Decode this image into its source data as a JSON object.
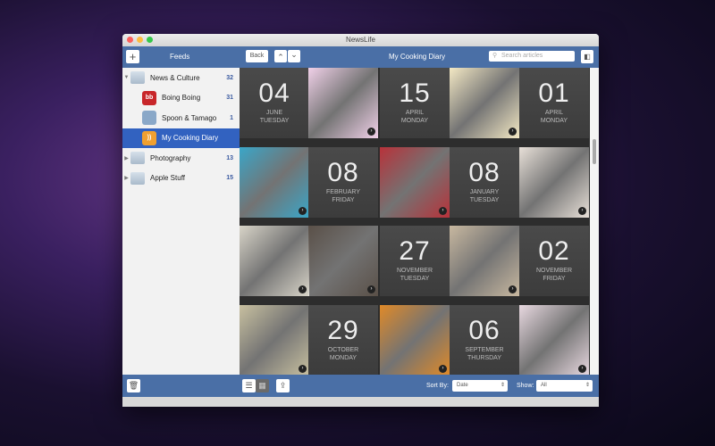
{
  "window": {
    "title": "NewsLife"
  },
  "toolbar": {
    "add": "+",
    "feeds": "Feeds",
    "back": "Back",
    "up": "⌃",
    "down": "⌄",
    "title": "My Cooking Diary",
    "search_placeholder": "Search articles"
  },
  "sidebar": {
    "items": [
      {
        "label": "News & Culture",
        "count": "32",
        "type": "folder",
        "expanded": true
      },
      {
        "label": "Boing Boing",
        "count": "31",
        "type": "feed"
      },
      {
        "label": "Spoon & Tamago",
        "count": "1",
        "type": "feed"
      },
      {
        "label": "My Cooking Diary",
        "count": "",
        "type": "feed",
        "selected": true
      },
      {
        "label": "Photography",
        "count": "13",
        "type": "folder"
      },
      {
        "label": "Apple Stuff",
        "count": "15",
        "type": "folder"
      }
    ]
  },
  "grid": [
    [
      {
        "day": "04",
        "month": "June",
        "weekday": "Tuesday"
      },
      {
        "img": "#f0d0e8"
      },
      {
        "day": "15",
        "month": "April",
        "weekday": "Monday"
      },
      {
        "img": "#f3e8c4"
      },
      {
        "day": "01",
        "month": "April",
        "weekday": "Monday"
      }
    ],
    [
      {
        "img": "#3aa6c8"
      },
      {
        "day": "08",
        "month": "February",
        "weekday": "Friday"
      },
      {
        "img": "#b8323a"
      },
      {
        "day": "08",
        "month": "January",
        "weekday": "Tuesday"
      },
      {
        "img": "#e8e0d8"
      }
    ],
    [
      {
        "img": "#d8d4c8"
      },
      {
        "img": "#5a5048"
      },
      {
        "day": "27",
        "month": "November",
        "weekday": "Tuesday"
      },
      {
        "img": "#c8b8a0"
      },
      {
        "day": "02",
        "month": "November",
        "weekday": "Friday"
      }
    ],
    [
      {
        "img": "#c8c0a0"
      },
      {
        "day": "29",
        "month": "October",
        "weekday": "Monday"
      },
      {
        "img": "#e08a28"
      },
      {
        "day": "06",
        "month": "September",
        "weekday": "Thursday"
      },
      {
        "img": "#e8d8e0"
      }
    ]
  ],
  "bottom": {
    "sort_label": "Sort By:",
    "sort_value": "Date",
    "show_label": "Show:",
    "show_value": "All"
  }
}
